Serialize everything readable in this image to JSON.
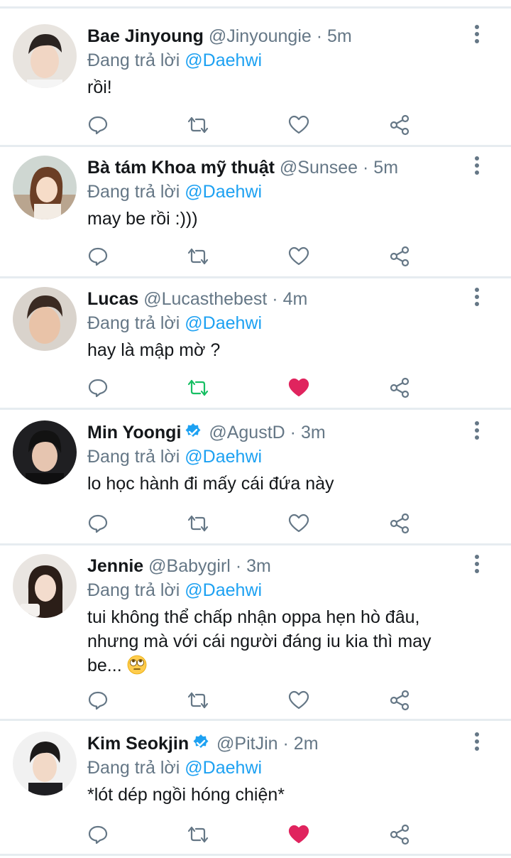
{
  "replying_prefix": "Đang trả lời",
  "colors": {
    "text": "#14171a",
    "secondary": "#657786",
    "accent": "#1da1f2",
    "like_active": "#e0245e",
    "retweet_active": "#17bf63",
    "divider": "#e6ecf0"
  },
  "tweets": [
    {
      "name": "Bae Jinyoung",
      "handle": "@Jinyoungie",
      "time": "5m",
      "verified": false,
      "reply_to": "@Daehwi",
      "text_lines": [
        "rồi!"
      ],
      "liked": false,
      "retweeted": false
    },
    {
      "name": "Bà tám Khoa mỹ thuật",
      "handle": "@Sunsee",
      "time": "5m",
      "verified": false,
      "reply_to": "@Daehwi",
      "text_lines": [
        "may be rồi :)))"
      ],
      "liked": false,
      "retweeted": false
    },
    {
      "name": "Lucas",
      "handle": "@Lucasthebest",
      "time": "4m",
      "verified": false,
      "reply_to": "@Daehwi",
      "text_lines": [
        "hay là mập mờ ?"
      ],
      "liked": true,
      "retweeted": true
    },
    {
      "name": "Min Yoongi",
      "handle": "@AgustD",
      "time": "3m",
      "verified": true,
      "reply_to": "@Daehwi",
      "text_lines": [
        "lo học hành đi mấy cái đứa này"
      ],
      "liked": false,
      "retweeted": false
    },
    {
      "name": "Jennie",
      "handle": "@Babygirl",
      "time": "3m",
      "verified": false,
      "reply_to": "@Daehwi",
      "text_lines": [
        "tui không thể chấp nhận oppa hẹn hò đâu,",
        "nhưng mà với cái người đáng iu kia thì may",
        "be..."
      ],
      "emoji": "rolling-eyes-emoji",
      "liked": false,
      "retweeted": false
    },
    {
      "name": "Kim Seokjin",
      "handle": "@PitJin",
      "time": "2m",
      "verified": true,
      "reply_to": "@Daehwi",
      "text_lines": [
        "*lót dép ngồi hóng chiện*"
      ],
      "liked": true,
      "retweeted": false
    }
  ]
}
